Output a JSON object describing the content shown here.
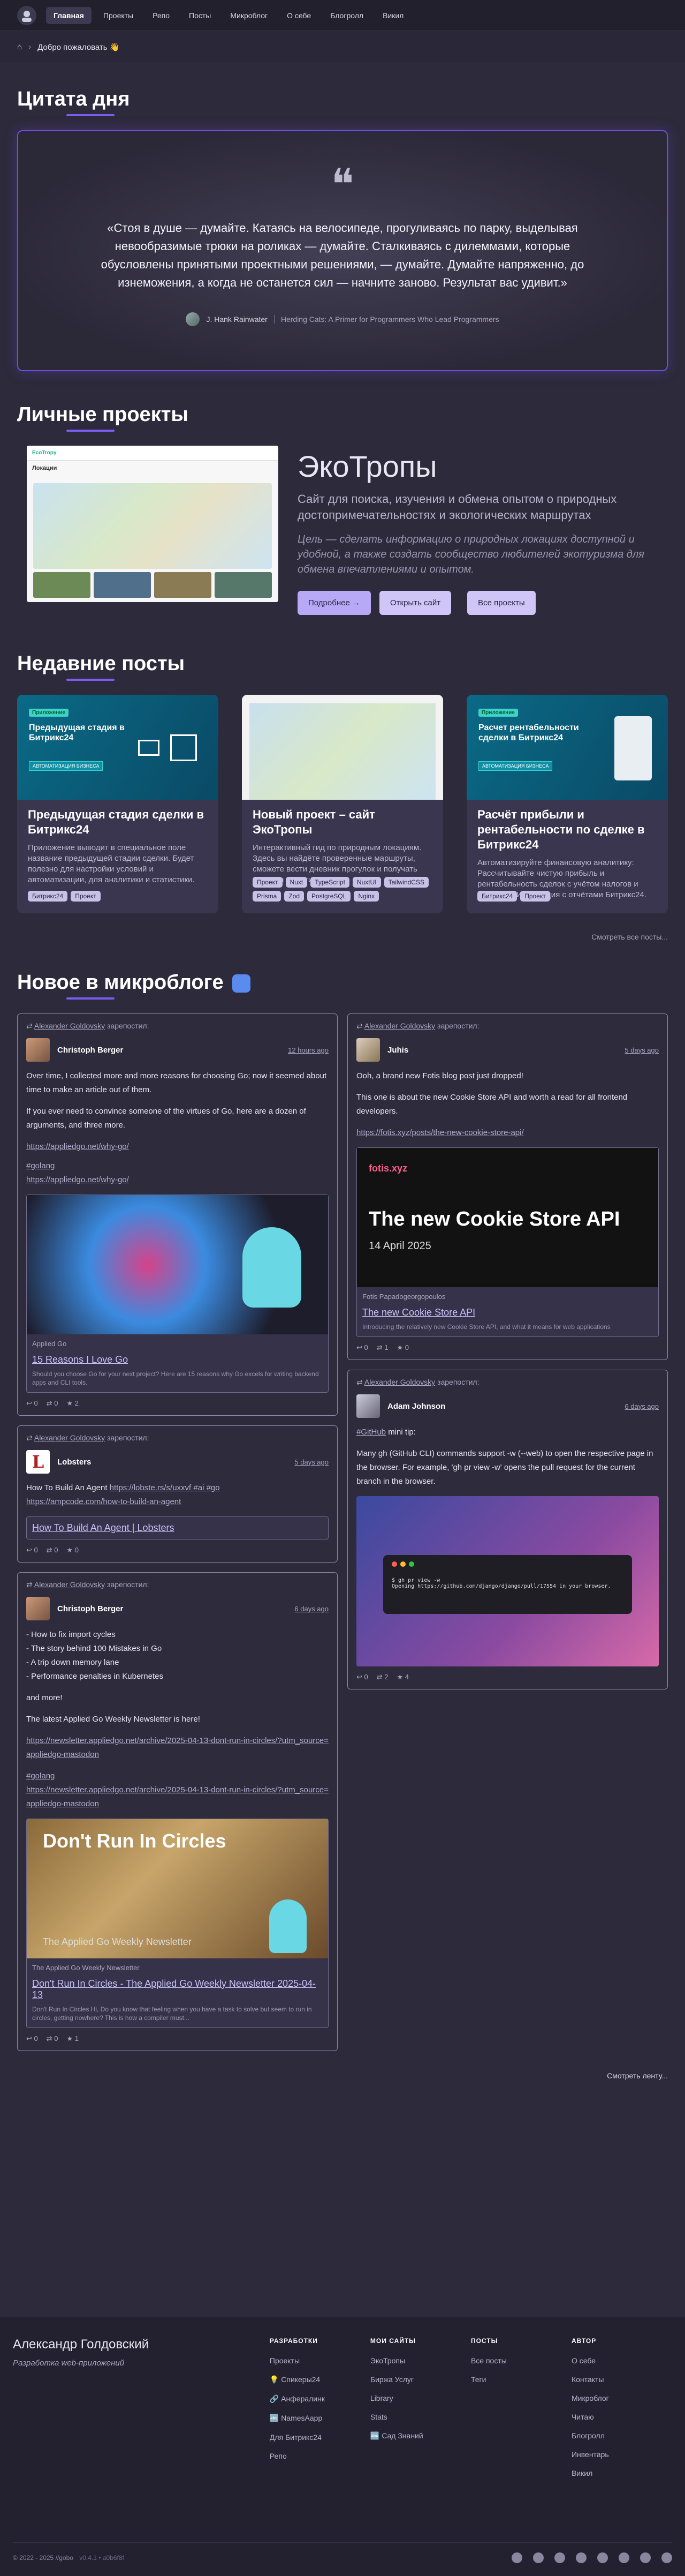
{
  "nav": {
    "items": [
      "Главная",
      "Проекты",
      "Репо",
      "Посты",
      "Микроблог",
      "О себе",
      "Блогролл",
      "Викил"
    ]
  },
  "breadcrumb": {
    "current": "Добро пожаловать 👋"
  },
  "quote": {
    "section_title": "Цитата дня",
    "text": "«Стоя в душе — думайте. Катаясь на велосипеде, прогуливаясь по парку, выделывая невообразимые трюки на роликах — думайте. Сталкиваясь с дилеммами, которые обусловлены принятыми проектными решениями, — думайте. Думайте напряженно, до изнеможения, а когда не останется сил — начните заново. Результат вас удивит.»",
    "author": "J. Hank Rainwater",
    "source": "Herding Cats: A Primer for Programmers Who Lead Programmers"
  },
  "projects": {
    "section_title": "Личные проекты",
    "name": "ЭкоТропы",
    "description": "Сайт для поиска, изучения и обмена опытом о природных достопримечательностях и экологических маршрутах",
    "goal": "Цель — сделать информацию о природных локациях доступной и удобной, а также создать сообщество любителей экотуризма для обмена впечатлениями и опытом.",
    "btn_more": "Подробнее →",
    "btn_open": "Открыть сайт",
    "btn_all": "Все проекты",
    "shot_logo": "EcoTropy",
    "shot_heading": "Локации"
  },
  "posts": {
    "section_title": "Недавние посты",
    "see_all": "Смотреть все посты...",
    "items": [
      {
        "title": "Предыдущая стадия сделки в Битрикс24",
        "desc": "Приложение выводит в специальное поле название предыдущей стадии сделки. Будет полезно для настройки условий и автоматизации, для аналитики и статистики.",
        "img_badge": "Приложение",
        "img_title": "Предыдущая стадия в Битрикс24",
        "img_sub": "АВТОМАТИЗАЦИЯ БИЗНЕСА",
        "tags": [
          "Битрикс24",
          "Проект"
        ]
      },
      {
        "title": "Новый проект – сайт ЭкоТропы",
        "desc": "Интерактивный гид по природным локациям. Здесь вы найдёте проверенные маршруты, сможете вести дневник прогулок и получать награды за активность.",
        "tags": [
          "Проект",
          "Nuxt",
          "TypeScript",
          "NuxtUI",
          "TailwindCSS",
          "Prisma",
          "Zod",
          "PostgreSQL",
          "Nginx"
        ]
      },
      {
        "title": "Расчёт прибыли и рентабельности по сделке в Битрикс24",
        "desc": "Автоматизируйте финансовую аналитику: Рассчитывайте чистую прибыль и рентабельность сделок с учётом налогов и расходов. Интеграция с отчётами Битрикс24.",
        "img_badge": "Приложение",
        "img_title": "Расчет рентабельности сделки в Битрикс24",
        "img_sub": "АВТОМАТИЗАЦИЯ БИЗНЕСА",
        "tags": [
          "Битрикс24",
          "Проект"
        ]
      }
    ]
  },
  "microblog": {
    "section_title": "Новое в микроблоге",
    "reposted_by": "Alexander Goldovsky",
    "reposted_label": "зарепостил:",
    "see_feed": "Смотреть ленту...",
    "left": [
      {
        "author": "Christoph Berger",
        "date": "12 hours ago",
        "p1": "Over time, I collected more and more reasons for choosing Go; now it seemed about time to make an article out of them.",
        "p2": "If you ever need to convince someone of the virtues of Go, here are a dozen of arguments, and three more.",
        "link1": "https://appliedgo.net/why-go/",
        "hashtag": "#golang",
        "link2": "https://appliedgo.net/why-go/",
        "preview_site": "Applied Go",
        "preview_title": "15 Reasons I Love Go",
        "preview_desc": "Should you choose Go for your next project? Here are 15 reasons why Go excels for writing backend apps and CLI tools.",
        "actions": [
          "0",
          "0",
          "2"
        ]
      },
      {
        "author": "Lobsters",
        "date": "5 days ago",
        "text_prefix": "How To Build An Agent",
        "link1": "https://lobste.rs/s/uxxvf #ai #go",
        "link2": "https://ampcode.com/how-to-build-an-agent",
        "preview_title": "How To Build An Agent | Lobsters",
        "actions": [
          "0",
          "0",
          "0"
        ]
      },
      {
        "author": "Christoph Berger",
        "date": "6 days ago",
        "list": [
          "- How to fix import cycles",
          "- The story behind 100 Mistakes in Go",
          "- A trip down memory lane",
          "- Performance penalties in Kubernetes"
        ],
        "more": "and more!",
        "latest": "The latest Applied Go Weekly Newsletter is here!",
        "link1": "https://newsletter.appliedgo.net/archive/2025-04-13-dont-run-in-circles/?utm_source=appliedgo-mastodon",
        "hashtag": "#golang",
        "link2": "https://newsletter.appliedgo.net/archive/2025-04-13-dont-run-in-circles/?utm_source=appliedgo-mastodon",
        "img_title": "Don't Run In Circles",
        "img_sub": "The Applied Go Weekly Newsletter",
        "preview_site": "The Applied Go Weekly Newsletter",
        "preview_title": "Don't Run In Circles - The Applied Go Weekly Newsletter 2025-04-13",
        "preview_desc": "Don't Run In Circles Hi, Do you know that feeling when you have a task to solve but seem to run in circles, getting nowhere? This is how a compiler must...",
        "actions": [
          "0",
          "0",
          "1"
        ]
      }
    ],
    "right": [
      {
        "author": "Juhis",
        "date": "5 days ago",
        "p1": "Ooh, a brand new Fotis blog post just dropped!",
        "p2": "This one is about the new Cookie Store API and worth a read for all frontend developers.",
        "link1": "https://fotis.xyz/posts/the-new-cookie-store-api/",
        "img_site": "fotis.xyz",
        "img_title": "The new Cookie Store API",
        "img_date": "14 April 2025",
        "preview_site": "Fotis Papadogeorgopoulos",
        "preview_title": "The new Cookie Store API",
        "preview_desc": "Introducing the relatively new Cookie Store API, and what it means for web applications",
        "actions": [
          "0",
          "1",
          "0"
        ]
      },
      {
        "author": "Adam Johnson",
        "date": "6 days ago",
        "hashtag": "#GitHub",
        "tip": "mini tip:",
        "p1": "Many gh (GitHub CLI) commands support -w (--web) to open the respective page in the browser. For example, 'gh pr view -w' opens the pull request for the current branch in the browser.",
        "term_cmd": "$ gh pr view -w",
        "term_out": "Opening https://github.com/django/django/pull/17554 in your browser.",
        "actions": [
          "0",
          "2",
          "4"
        ]
      }
    ]
  },
  "footer": {
    "name": "Александр Голдовский",
    "role": "Разработка web-приложений",
    "cols": [
      {
        "title": "РАЗРАБОТКИ",
        "links": [
          "Проекты",
          "💡 Спикеры24",
          "🔗 Анфералинк",
          "🔤 NamesAapp",
          "Для Битрикс24",
          "Репо"
        ]
      },
      {
        "title": "МОИ САЙТЫ",
        "links": [
          "ЭкоТропы",
          "Биржа Услуг",
          "Library",
          "Stats",
          "🔤 Сад Знаний"
        ]
      },
      {
        "title": "ПОСТЫ",
        "links": [
          "Все посты",
          "Теги"
        ]
      },
      {
        "title": "АВТОР",
        "links": [
          "О себе",
          "Контакты",
          "Микроблог",
          "Читаю",
          "Блогролл",
          "Инвентарь",
          "Викил"
        ]
      }
    ],
    "copyright": "© 2022 - 2025 //gobo",
    "version": "v0.4.1 • a0b6f8f"
  }
}
